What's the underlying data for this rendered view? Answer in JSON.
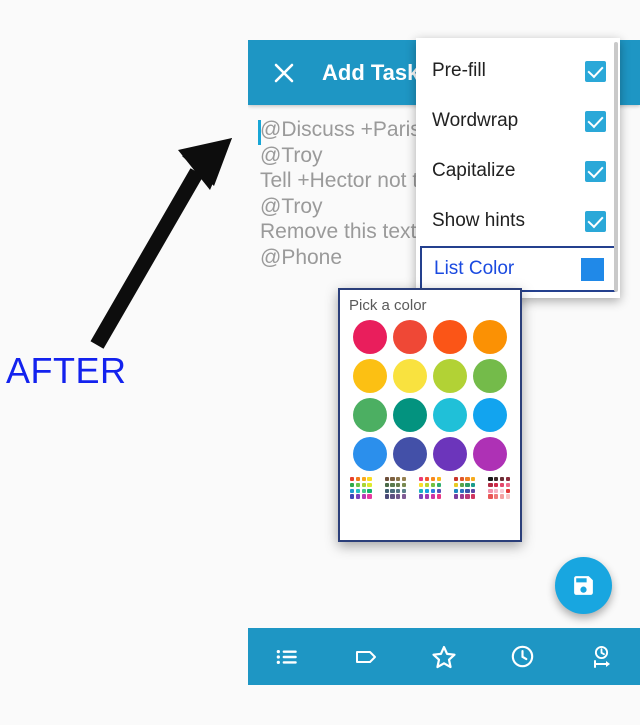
{
  "annotation": {
    "label": "AFTER",
    "label_color": "#1322ee",
    "arrow_color": "#0d0d0d",
    "arrow_icon": "arrow-up-right-icon"
  },
  "app": {
    "bar": {
      "title": "Add Task",
      "background": "#1e96c4",
      "close_icon": "close-icon"
    },
    "editor": {
      "caret_color": "#18a6d6",
      "hint_color": "#9a9a9a",
      "lines": [
        "@Discuss +Paris",
        "@Troy",
        "Tell +Hector not to",
        "@Troy",
        "Remove this text",
        "@Phone"
      ]
    },
    "fab": {
      "name": "save-fab",
      "icon": "save-floppy-icon",
      "background": "#18a6e0"
    },
    "bottom_nav": [
      {
        "name": "nav-lists",
        "icon": "list-icon"
      },
      {
        "name": "nav-tags",
        "icon": "tag-icon"
      },
      {
        "name": "nav-priority",
        "icon": "star-icon"
      },
      {
        "name": "nav-time",
        "icon": "clock-icon"
      },
      {
        "name": "nav-duration",
        "icon": "clock-arrow-icon"
      }
    ]
  },
  "overflow_menu": {
    "items": [
      {
        "label": "Pre-fill",
        "checked": true,
        "type": "checkbox"
      },
      {
        "label": "Wordwrap",
        "checked": true,
        "type": "checkbox"
      },
      {
        "label": "Capitalize",
        "checked": true,
        "type": "checkbox"
      },
      {
        "label": "Show hints",
        "checked": true,
        "type": "checkbox"
      },
      {
        "label": "List Color",
        "checked": false,
        "type": "color",
        "swatch": "#2089e8",
        "focused": true
      }
    ],
    "checkbox_color": "#2aa8d8",
    "focus_border": "#24408e",
    "focus_text": "#1a4ae0"
  },
  "color_picker": {
    "title": "Pick a color",
    "border_color": "#2b3f7a",
    "swatches": [
      "#e91e5c",
      "#ef4836",
      "#fb5517",
      "#fb9104",
      "#fcc013",
      "#f9e23f",
      "#b2d235",
      "#74bb4a",
      "#4caf62",
      "#03937f",
      "#20c0d8",
      "#12a4ef",
      "#2b8fec",
      "#4350a8",
      "#6c35bb",
      "#ae31b5"
    ],
    "mini_palettes": [
      [
        "#e8412b",
        "#f07b1b",
        "#f9a81c",
        "#fbdd22",
        "#2fab4d",
        "#6dc64a",
        "#a9d536",
        "#ddea2d",
        "#1f9ad4",
        "#22c0c4",
        "#45c98b",
        "#14b06a",
        "#4048b5",
        "#7a40be",
        "#b93cb6",
        "#e73aa0"
      ],
      [
        "#6d4f3a",
        "#7d6141",
        "#8a7348",
        "#958050",
        "#4a6b48",
        "#5a7a4e",
        "#697f4f",
        "#7a8a52",
        "#3f5f72",
        "#4a6b7c",
        "#527382",
        "#5c7f8a",
        "#4a4a78",
        "#5d5282",
        "#6f568b",
        "#7f5b94"
      ],
      [
        "#ec3b74",
        "#f2562f",
        "#f8891c",
        "#fbb71c",
        "#fadd2a",
        "#bad62f",
        "#73c244",
        "#2fae6e",
        "#1bb4c4",
        "#17a0e2",
        "#2f7bdf",
        "#5252b8",
        "#7a46bb",
        "#a13ab4",
        "#cf35a4",
        "#ea3785"
      ],
      [
        "#c9362b",
        "#e1582a",
        "#ef8322",
        "#f6ab1e",
        "#e7cb24",
        "#59a44a",
        "#2f9d66",
        "#1b9c8c",
        "#1d87c1",
        "#2a6fc2",
        "#3c52aa",
        "#5a45a5",
        "#7a3f9e",
        "#9c3a92",
        "#b93879",
        "#cf3660"
      ],
      [
        "#1a1a1a",
        "#3f2b2b",
        "#6a2d35",
        "#8c2c3c",
        "#b02a42",
        "#d12b4a",
        "#e4466b",
        "#ee6b8c",
        "#f190a9",
        "#f5b2c2",
        "#f8cdd7",
        "#e33a3a",
        "#e85555",
        "#ef7a7a",
        "#f4a0a0",
        "#f8c4c4"
      ]
    ]
  }
}
